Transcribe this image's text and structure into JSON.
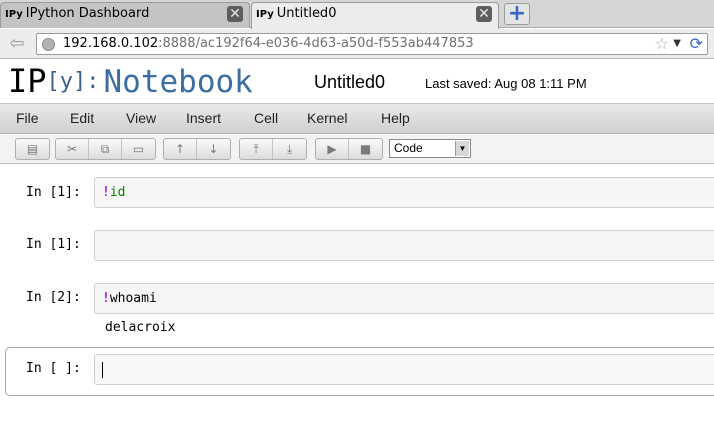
{
  "browser": {
    "tabs": [
      {
        "favicon": "IPy",
        "label": "IPython Dashboard",
        "active": false
      },
      {
        "favicon": "IPy",
        "label": "Untitled0",
        "active": true
      }
    ],
    "url_host": "192.168.0.102",
    "url_path": ":8888/ac192f64-e036-4d63-a50d-f553ab447853"
  },
  "header": {
    "logo_ip": "IP",
    "logo_y": "[y]:",
    "logo_nb": "Notebook",
    "title": "Untitled0",
    "last_saved": "Last saved: Aug 08 1:11 PM"
  },
  "menu": [
    "File",
    "Edit",
    "View",
    "Insert",
    "Cell",
    "Kernel",
    "Help"
  ],
  "toolbar": {
    "cell_type": "Code"
  },
  "cells": [
    {
      "prompt": "In [1]:",
      "bang": "!",
      "command": "id",
      "output": ""
    },
    {
      "prompt": "In [1]:",
      "bang": "",
      "command": "",
      "output": ""
    },
    {
      "prompt": "In [2]:",
      "bang": "!",
      "command": "whoami",
      "output": "delacroix"
    },
    {
      "prompt": "In [ ]:",
      "bang": "",
      "command": "",
      "output": ""
    }
  ]
}
